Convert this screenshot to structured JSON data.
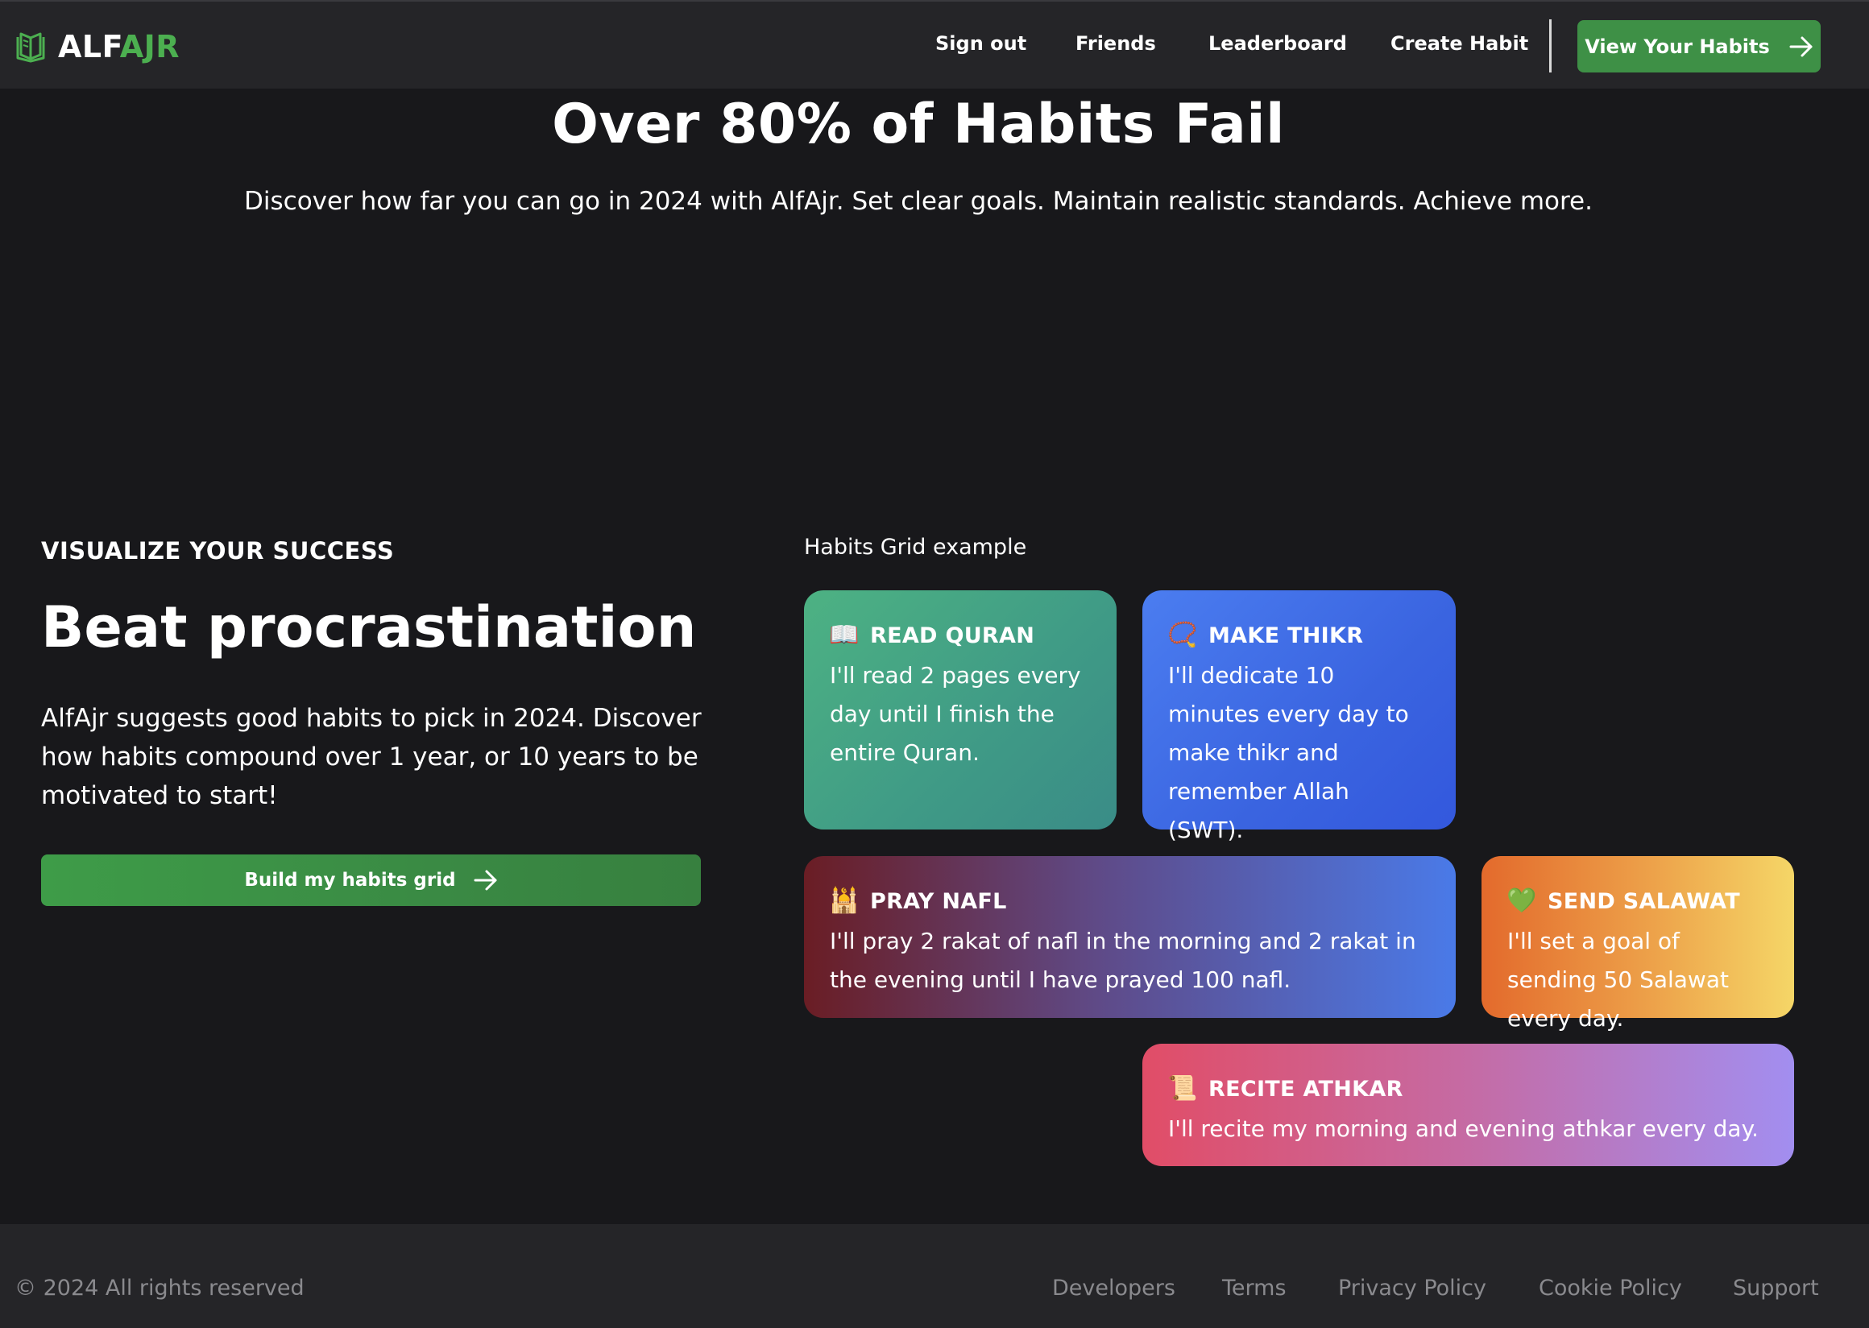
{
  "nav": {
    "logo_part1": "ALF",
    "logo_part2": "AJR",
    "links": [
      "Sign out",
      "Friends",
      "Leaderboard",
      "Create Habit"
    ],
    "cta_label": "View Your Habits"
  },
  "hero": {
    "title": "Over 80% of Habits Fail",
    "subtitle": "Discover how far you can go in 2024 with AlfAjr. Set clear goals. Maintain realistic standards. Achieve more."
  },
  "section": {
    "eyebrow": "VISUALIZE YOUR SUCCESS",
    "heading": "Beat procrastination",
    "description": "AlfAjr suggests good habits to pick in 2024. Discover how habits compound over 1 year, or 10 years to be motivated to start!",
    "button_label": "Build my habits grid"
  },
  "grid": {
    "label": "Habits Grid example",
    "cards": [
      {
        "emoji": "📖",
        "title": "READ QURAN",
        "text": "I'll read 2 pages every day until I finish the entire Quran."
      },
      {
        "emoji": "📿",
        "title": "MAKE THIKR",
        "text": "I'll dedicate 10 minutes every day to make thikr and remember Allah (SWT)."
      },
      {
        "emoji": "🕌",
        "title": "PRAY NAFL",
        "text": "I'll pray 2 rakat of nafl in the morning and 2 rakat in the evening until I have prayed 100 nafl."
      },
      {
        "emoji": "💚",
        "title": "SEND SALAWAT",
        "text": "I'll set a goal of sending 50 Salawat every day."
      },
      {
        "emoji": "📜",
        "title": "RECITE ATHKAR",
        "text": "I'll recite my morning and evening athkar every day."
      }
    ]
  },
  "footer": {
    "copyright": "© 2024 All rights reserved",
    "links": [
      "Developers",
      "Terms",
      "Privacy Policy",
      "Cookie Policy",
      "Support"
    ]
  },
  "colors": {
    "background": "#18181b",
    "navbar": "#252528",
    "accent_green": "#3e9046"
  }
}
